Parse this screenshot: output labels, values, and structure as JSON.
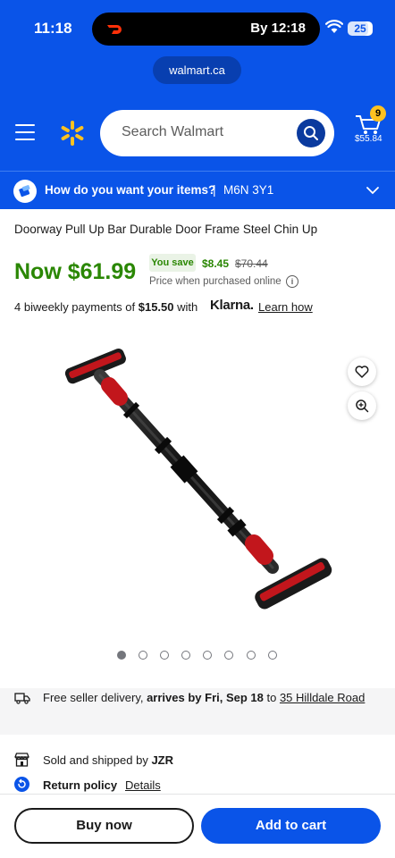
{
  "status_bar": {
    "time": "11:18",
    "live_activity": "By 12:18",
    "battery": "25"
  },
  "browser": {
    "url": "walmart.ca"
  },
  "header": {
    "search_placeholder": "Search Walmart",
    "cart_count": "9",
    "cart_total": "$55.84"
  },
  "delivery_bar": {
    "question": "How do you want your items?",
    "separator": "|",
    "postal_code": "M6N 3Y1"
  },
  "product": {
    "title": "Doorway Pull Up Bar Durable Door Frame Steel Chin Up",
    "now_price": "Now $61.99",
    "you_save_label": "You save",
    "save_amount": "$8.45",
    "was_price": "$70.44",
    "price_note": "Price when purchased online",
    "info_icon_glyph": "i"
  },
  "klarna": {
    "prefix": "4 biweekly payments of ",
    "amount": "$15.50",
    "suffix": " with",
    "brand": "Klarna.",
    "learn_link": "Learn how"
  },
  "gallery": {
    "image_count": 8,
    "active_index": 0
  },
  "shipping": {
    "prefix": "Free seller delivery, ",
    "arrival": "arrives by Fri, Sep 18",
    "middle": " to ",
    "address": "35 Hilldale Road"
  },
  "seller": {
    "label": "Sold and shipped by ",
    "name": "JZR"
  },
  "returns": {
    "label": "Return policy",
    "link": "Details"
  },
  "actions": {
    "buy_now": "Buy now",
    "add_to_cart": "Add to cart"
  },
  "colors": {
    "brand_blue": "#0a54e8",
    "spark_yellow": "#ffc220",
    "price_green": "#2a8703"
  }
}
